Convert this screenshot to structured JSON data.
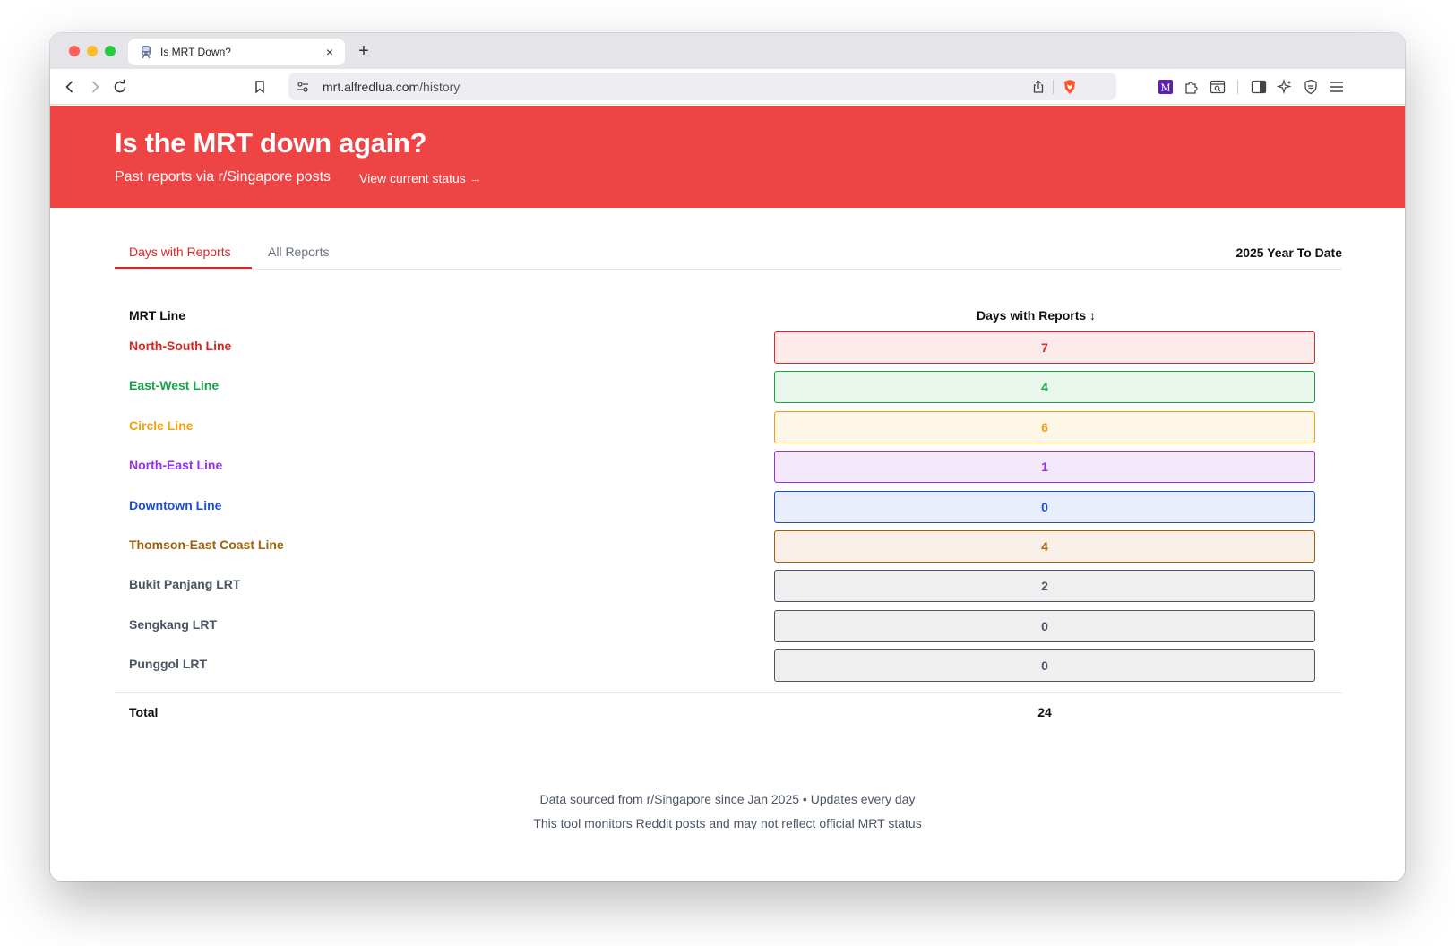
{
  "browser": {
    "tab_title": "Is MRT Down?",
    "tab_close": "×",
    "new_tab": "+",
    "url_host": "mrt.alfredlua.com",
    "url_path": "/history"
  },
  "hero": {
    "title": "Is the MRT down again?",
    "subtitle": "Past reports via r/Singapore posts",
    "link": "View current status →",
    "color": "#ef4444"
  },
  "tabs": {
    "active": "Days with Reports",
    "inactive": "All Reports",
    "period": "2025 Year To Date"
  },
  "table": {
    "col_line": "MRT Line",
    "col_days": "Days with Reports ↕",
    "rows": [
      {
        "line": "North-South Line",
        "days": "7",
        "color": "#dc2626",
        "bg": "#fdeaea",
        "border": "#dc2626"
      },
      {
        "line": "East-West Line",
        "days": "4",
        "color": "#16a34a",
        "bg": "#e8f6ec",
        "border": "#16a34a"
      },
      {
        "line": "Circle Line",
        "days": "6",
        "color": "#f59e0b",
        "bg": "#fef6e7",
        "border": "#f59e0b"
      },
      {
        "line": "North-East Line",
        "days": "1",
        "color": "#9333ea",
        "bg": "#f4e8fb",
        "border": "#9333ea"
      },
      {
        "line": "Downtown Line",
        "days": "0",
        "color": "#1d4ed8",
        "bg": "#e8eefb",
        "border": "#1d4ed8"
      },
      {
        "line": "Thomson-East Coast Line",
        "days": "4",
        "color": "#a16207",
        "bg": "#f7efe8",
        "border": "#a16207"
      },
      {
        "line": "Bukit Panjang LRT",
        "days": "2",
        "color": "#4b5563",
        "bg": "#efefef",
        "border": "#4b5563"
      },
      {
        "line": "Sengkang LRT",
        "days": "0",
        "color": "#4b5563",
        "bg": "#efefef",
        "border": "#4b5563"
      },
      {
        "line": "Punggol LRT",
        "days": "0",
        "color": "#4b5563",
        "bg": "#efefef",
        "border": "#4b5563"
      }
    ],
    "total_label": "Total",
    "total_value": "24"
  },
  "footer": {
    "line1": "Data sourced from r/Singapore since Jan 2025 • Updates every day",
    "line2": "This tool monitors Reddit posts and may not reflect official MRT status"
  }
}
